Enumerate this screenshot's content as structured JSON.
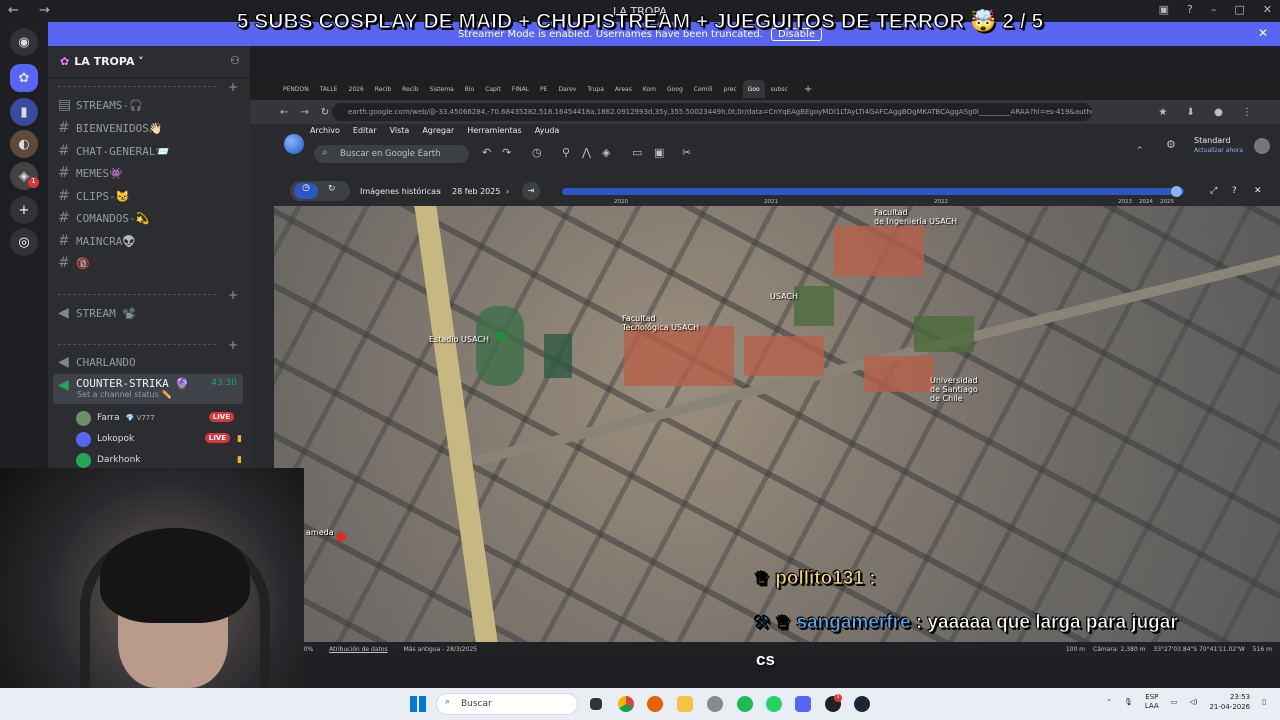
{
  "window": {
    "title": "LA TROPA",
    "nav_icons": "← →",
    "controls": [
      "▣",
      "?",
      "–",
      "□",
      "✕"
    ]
  },
  "banner": {
    "text": "Streamer Mode is enabled. Usernames have been truncated.",
    "button": "Disable"
  },
  "stream_title": "5 SUBS COSPLAY DE MAID + CHUPISTREAM + JUEGUITOS DE TERROR 🤯 2 / 5",
  "rail": {
    "badge_count": "1"
  },
  "server": {
    "name": "LA TROPA ˅"
  },
  "channels": [
    {
      "name": "STREAMS-🎧",
      "type": "text"
    },
    {
      "name": "BIENVENIDOS👋🏻",
      "type": "text"
    },
    {
      "name": "CHAT-GENERAL📨",
      "type": "text"
    },
    {
      "name": "MEMES👾",
      "type": "text"
    },
    {
      "name": "CLIPS-😼",
      "type": "text"
    },
    {
      "name": "COMANDOS-💫",
      "type": "text"
    },
    {
      "name": "MAINCRA👽",
      "type": "text"
    },
    {
      "name": "🔞",
      "type": "text"
    }
  ],
  "stream_channel": {
    "name": "STREAM 📽️"
  },
  "voice_channels": [
    {
      "name": "CHARLANDO"
    },
    {
      "name": "COUNTER-STRIKA 🔮",
      "timer": "43:30",
      "status": "Set a channel status ✏️"
    }
  ],
  "voice_users": [
    {
      "name": "Farra",
      "extra": "💎 V777",
      "live": "LIVE"
    },
    {
      "name": "Lokopok",
      "live": "LIVE"
    },
    {
      "name": "Darkhonk",
      "live": ""
    }
  ],
  "browser": {
    "tabs": [
      "PENDON",
      "TALLE",
      "2026",
      "Recib",
      "Recib",
      "Sistema",
      "Bio",
      "Capit",
      "FINAL",
      "PE",
      "Darev",
      "Trupa",
      "Areas",
      "Kom",
      "Goog",
      "Cemili",
      "prec",
      "Goo",
      "subsc"
    ],
    "url": "earth.google.com/web/@-33.45066284,-70.68435282,518.16454418a,1862.0912993d,35y,355.50023449h,0t,0r/data=CnYqEAgBEgoyMDI1LTAyLTI4GAFCAggBOgMKATBCAggASg0I_________ARAA?hl=es-419&authuser=0",
    "earth_menu": [
      "Archivo",
      "Editar",
      "Vista",
      "Agregar",
      "Herramientas",
      "Ayuda"
    ],
    "search_placeholder": "Buscar en Google Earth",
    "standard_label": "Standard",
    "update_label": "Actualizar ahora",
    "hist_label": "Imágenes históricas",
    "hist_date": "28 feb 2025",
    "years": [
      "2020",
      "2021",
      "2022",
      "2023",
      "2024",
      "2025"
    ],
    "map_labels": {
      "facultad_ing": "Facultad\nde Ingeniería USACH",
      "usach": "USACH",
      "facultad_tec": "Facultad\nTecnológica USACH",
      "estadio": "Estadio USACH",
      "universidad": "Universidad\nde Santiago\nde Chile",
      "ameda": "ameda"
    },
    "status_bar": {
      "zoom": "100%",
      "attribution": "Atribución de datos",
      "recent": "Más antigua - 28/3/2025",
      "scale": "100 m",
      "camera": "Cámara: 2,380 m",
      "coords": "33°27'03.84\"S 70°41'11.02\"W",
      "elev": "516 m"
    }
  },
  "chat": [
    {
      "user": "pollito131",
      "message": ""
    },
    {
      "user": "sangamerfre",
      "message": "yaaaaa que larga para jugar"
    }
  ],
  "caption": "cs",
  "taskbar": {
    "search": "Buscar",
    "lang": "ESP",
    "region": "LAA",
    "time": "23:53",
    "date": "21-04-2026",
    "steam_badge": "1"
  },
  "colors": {
    "discord_accent": "#5865f2",
    "live_red": "#da373c",
    "voice_green": "#23a55a"
  }
}
